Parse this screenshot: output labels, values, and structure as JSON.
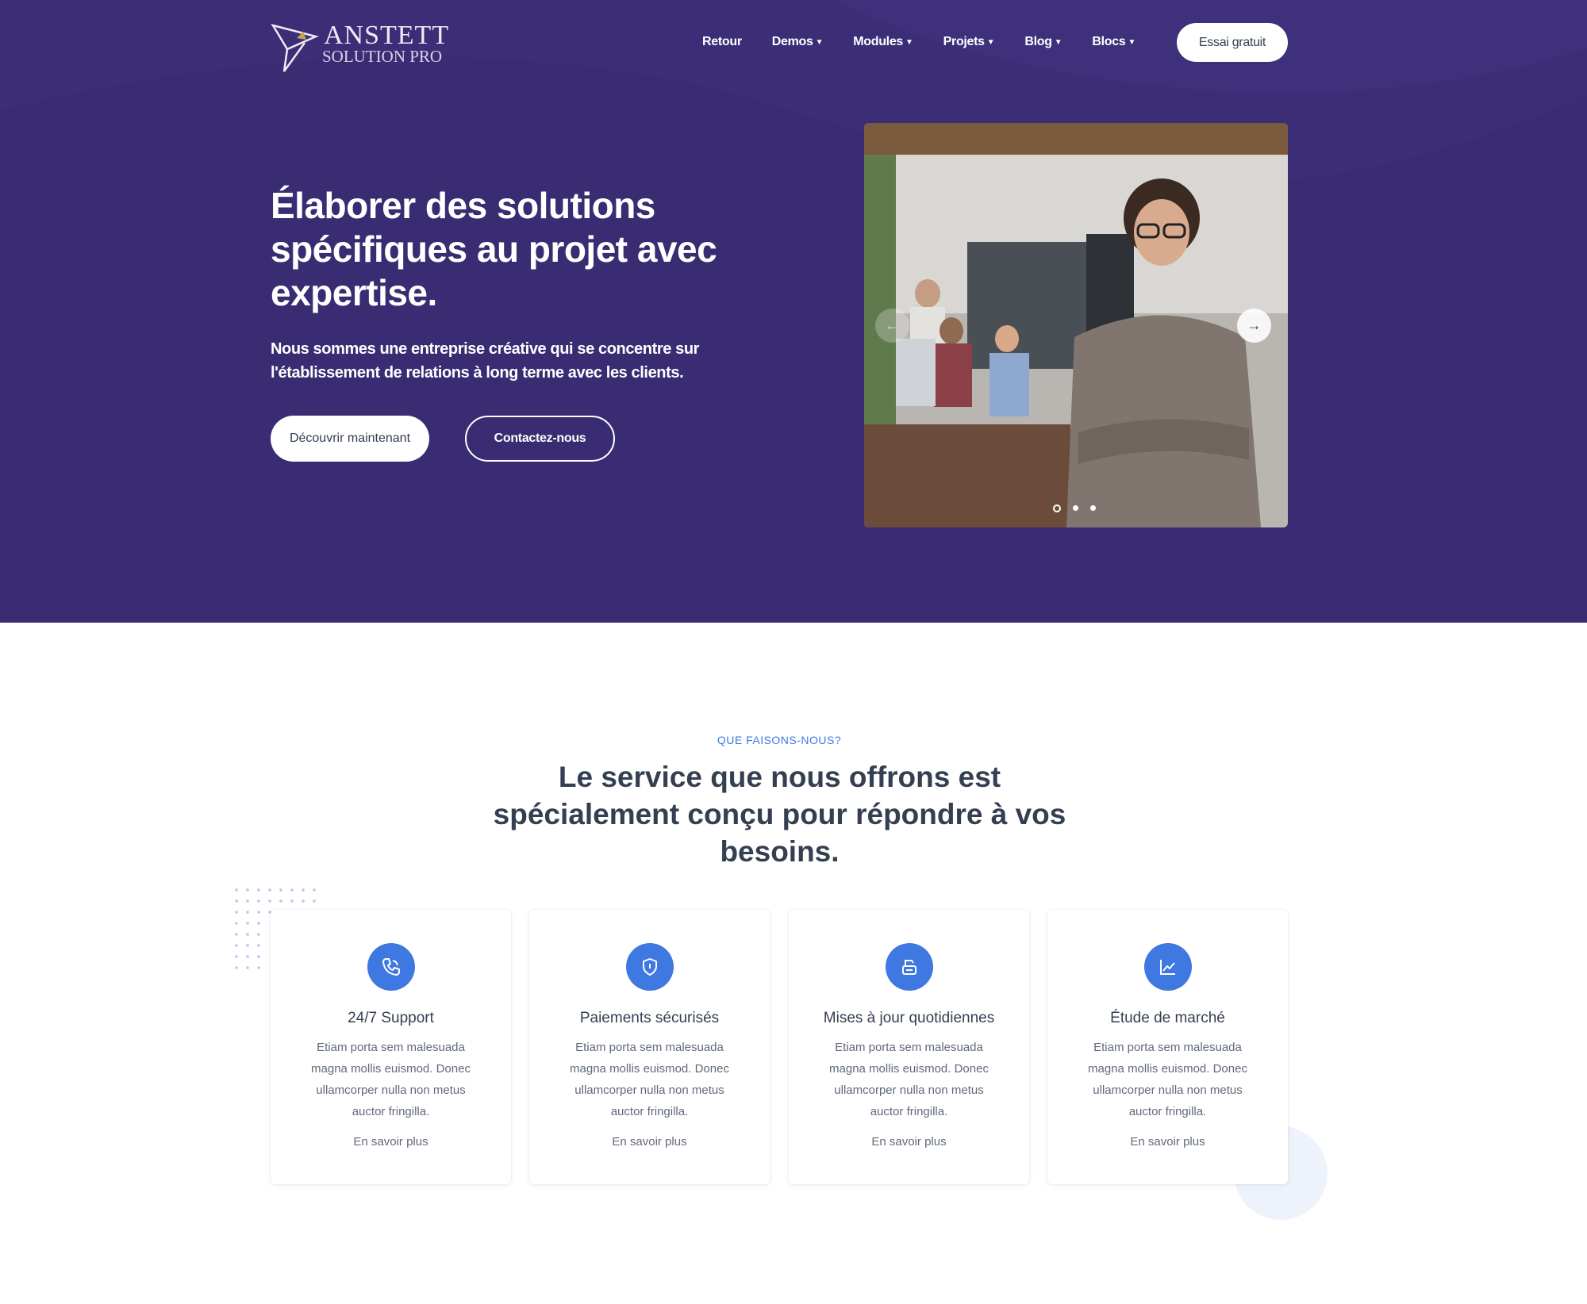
{
  "brand": {
    "name": "ANSTETT",
    "subtitle": "SOLUTION PRO"
  },
  "nav": {
    "items": [
      {
        "label": "Retour",
        "dropdown": false
      },
      {
        "label": "Demos",
        "dropdown": true
      },
      {
        "label": "Modules",
        "dropdown": true
      },
      {
        "label": "Projets",
        "dropdown": true
      },
      {
        "label": "Blog",
        "dropdown": true
      },
      {
        "label": "Blocs",
        "dropdown": true
      }
    ],
    "cta_label": "Essai gratuit"
  },
  "hero": {
    "title": "Élaborer des solutions spécifiques au projet avec expertise.",
    "text": "Nous sommes une entreprise créative qui se concentre sur l'établissement de relations à long terme avec les clients.",
    "primary_button": "Découvrir maintenant",
    "secondary_button": "Contactez-nous",
    "carousel": {
      "slides": 3,
      "active_slide": 1
    }
  },
  "services": {
    "eyebrow": "QUE FAISONS-NOUS?",
    "title": "Le service que nous offrons est spécialement conçu pour répondre à vos besoins.",
    "cards": [
      {
        "icon": "phone-icon",
        "title": "24/7 Support",
        "text": "Etiam porta sem malesuada magna mollis euismod. Donec ullamcorper nulla non metus auctor fringilla.",
        "link": "En savoir plus"
      },
      {
        "icon": "shield-icon",
        "title": "Paiements sécurisés",
        "text": "Etiam porta sem malesuada magna mollis euismod. Donec ullamcorper nulla non metus auctor fringilla.",
        "link": "En savoir plus"
      },
      {
        "icon": "update-icon",
        "title": "Mises à jour quotidiennes",
        "text": "Etiam porta sem malesuada magna mollis euismod. Donec ullamcorper nulla non metus auctor fringilla.",
        "link": "En savoir plus"
      },
      {
        "icon": "chart-icon",
        "title": "Étude de marché",
        "text": "Etiam porta sem malesuada magna mollis euismod. Donec ullamcorper nulla non metus auctor fringilla.",
        "link": "En savoir plus"
      }
    ]
  },
  "colors": {
    "hero_bg": "#3a2c72",
    "accent": "#3f78e0",
    "heading": "#343f52",
    "body_text": "#60697b"
  }
}
